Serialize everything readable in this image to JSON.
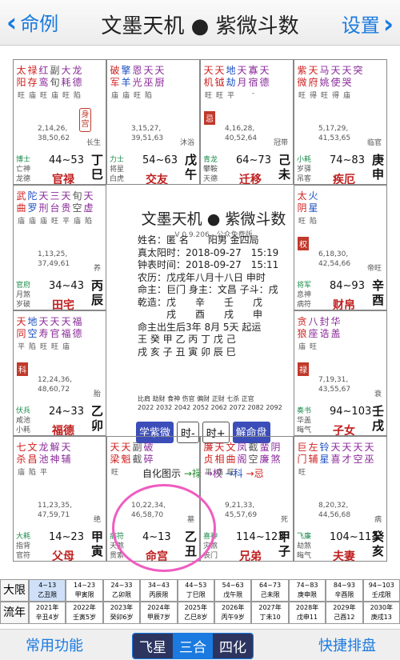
{
  "nav": {
    "back_label": "命例",
    "title": "文墨天机 ● 紫微斗数",
    "settings_label": "设置"
  },
  "cells": [
    {
      "id": "si",
      "col": 0,
      "row": 0,
      "stars": [
        {
          "n": "太阳",
          "c": "red",
          "b": "旺"
        },
        {
          "n": "禄存",
          "c": "red",
          "b": "庙"
        },
        {
          "n": "红鸾",
          "c": "purple",
          "b": "旺"
        },
        {
          "n": "副旬",
          "c": "gray",
          "b": "庙"
        },
        {
          "n": "大耗",
          "c": "purple",
          "b": "旺"
        },
        {
          "n": "龙德",
          "c": "purple",
          "b": "陷"
        }
      ],
      "ages": [
        "2,14,26,",
        "38,50,62"
      ],
      "cs": "长生",
      "gods": [
        "博士",
        "亡神",
        "龙德"
      ],
      "range": "44~53",
      "palace": "官禄",
      "stem": [
        "丁",
        "巳"
      ],
      "shen": "身宫"
    },
    {
      "id": "wu",
      "col": 1,
      "row": 0,
      "stars": [
        {
          "n": "破军",
          "c": "red",
          "b": "庙"
        },
        {
          "n": "擎羊",
          "c": "blue",
          "b": "庙"
        },
        {
          "n": "恩光",
          "c": "purple",
          "b": "旺"
        },
        {
          "n": "天巫",
          "c": "purple",
          "b": "陷"
        },
        {
          "n": "天厨",
          "c": "purple",
          "b": ""
        }
      ],
      "ages": [
        "3,15,27,",
        "39,51,63"
      ],
      "cs": "沐浴",
      "gods": [
        "力士",
        "将星",
        "白虎"
      ],
      "range": "54~63",
      "palace": "交友",
      "stem": [
        "戊",
        "午"
      ]
    },
    {
      "id": "wei",
      "col": 2,
      "row": 0,
      "stars": [
        {
          "n": "天机",
          "c": "red",
          "b": "旺"
        },
        {
          "n": "天钺",
          "c": "red",
          "b": "旺"
        },
        {
          "n": "地劫",
          "c": "blue",
          "b": "平"
        },
        {
          "n": "天月",
          "c": "purple",
          "b": ""
        },
        {
          "n": "寡宿",
          "c": "purple",
          "b": "-"
        },
        {
          "n": "天德",
          "c": "purple",
          "b": ""
        }
      ],
      "hua": "忌",
      "ages": [
        "4,16,28,",
        "40,52,64"
      ],
      "cs": "冠带",
      "gods": [
        "青龙",
        "攀鞍",
        "天德"
      ],
      "range": "64~73",
      "palace": "迁移",
      "stem": [
        "己",
        "未"
      ]
    },
    {
      "id": "shen",
      "col": 3,
      "row": 0,
      "stars": [
        {
          "n": "紫微",
          "c": "red",
          "b": "旺"
        },
        {
          "n": "天府",
          "c": "red",
          "b": "得"
        },
        {
          "n": "马姚",
          "c": "purple",
          "b": "旺"
        },
        {
          "n": "天使",
          "c": "purple",
          "b": "得"
        },
        {
          "n": "天哭",
          "c": "purple",
          "b": "庙"
        },
        {
          "n": "突",
          "c": "purple",
          "b": ""
        }
      ],
      "ages": [
        "5,17,29,",
        "41,53,65"
      ],
      "cs": "临官",
      "gods": [
        "小耗",
        "岁驿",
        "吊客"
      ],
      "range": "74~83",
      "palace": "疾厄",
      "stem": [
        "庚",
        "申"
      ]
    },
    {
      "id": "chen",
      "col": 0,
      "row": 1,
      "stars": [
        {
          "n": "武曲",
          "c": "red",
          "b": "庙"
        },
        {
          "n": "陀罗",
          "c": "blue",
          "b": "庙"
        },
        {
          "n": "天刑",
          "c": "purple",
          "b": "庙"
        },
        {
          "n": "三台",
          "c": "purple",
          "b": "旺"
        },
        {
          "n": "天贵",
          "c": "purple",
          "b": "平"
        },
        {
          "n": "旬空",
          "c": "gray",
          "b": "庙"
        },
        {
          "n": "天虚",
          "c": "purple",
          "b": "陷"
        }
      ],
      "ages": [
        "1,13,25,",
        "37,49,61"
      ],
      "cs": "养",
      "gods": [
        "官府",
        "月煞",
        "岁破"
      ],
      "range": "34~43",
      "palace": "田宅",
      "stem": [
        "丙",
        "辰"
      ]
    },
    {
      "id": "you",
      "col": 3,
      "row": 1,
      "stars": [
        {
          "n": "太阴",
          "c": "red",
          "b": "旺"
        },
        {
          "n": "火星",
          "c": "blue",
          "b": "陷"
        }
      ],
      "hua": "权",
      "ages": [
        "6,18,30,",
        "42,54,66"
      ],
      "cs": "帝旺",
      "gods": [
        "将军",
        "息神",
        "病符"
      ],
      "range": "84~93",
      "palace": "财帛",
      "stem": [
        "辛",
        "酉"
      ]
    },
    {
      "id": "mao",
      "col": 0,
      "row": 2,
      "stars": [
        {
          "n": "天同",
          "c": "red",
          "b": "平"
        },
        {
          "n": "地空",
          "c": "blue",
          "b": "陷"
        },
        {
          "n": "天寿",
          "c": "purple",
          "b": "旺"
        },
        {
          "n": "天官",
          "c": "purple",
          "b": "旺"
        },
        {
          "n": "天福",
          "c": "purple",
          "b": "庙"
        },
        {
          "n": "福德",
          "c": "purple",
          "b": ""
        }
      ],
      "hua": "科",
      "ages": [
        "12,24,36,",
        "48,60,72"
      ],
      "cs": "胎",
      "gods": [
        "伏兵",
        "咸池",
        "小耗"
      ],
      "range": "24~33",
      "palace": "福德",
      "stem": [
        "乙",
        "卯"
      ]
    },
    {
      "id": "xu",
      "col": 3,
      "row": 2,
      "stars": [
        {
          "n": "贪狼",
          "c": "red",
          "b": "庙"
        },
        {
          "n": "八座",
          "c": "purple",
          "b": "旺"
        },
        {
          "n": "封诰",
          "c": "purple",
          "b": ""
        },
        {
          "n": "华盖",
          "c": "purple",
          "b": ""
        }
      ],
      "hua": "禄",
      "ages": [
        "7,19,31,",
        "43,55,67"
      ],
      "cs": "衰",
      "gods": [
        "奏书",
        "华盖",
        "晦气"
      ],
      "range": "94~103",
      "palace": "子女",
      "stem": [
        "壬",
        "戌"
      ]
    },
    {
      "id": "yin",
      "col": 0,
      "row": 3,
      "stars": [
        {
          "n": "七杀",
          "c": "red",
          "b": "庙"
        },
        {
          "n": "文昌",
          "c": "red",
          "b": "陷"
        },
        {
          "n": "龙池",
          "c": "purple",
          "b": "平"
        },
        {
          "n": "解神",
          "c": "purple",
          "b": ""
        },
        {
          "n": "天辅",
          "c": "purple",
          "b": ""
        }
      ],
      "ages": [
        "11,23,35,",
        "47,59,71"
      ],
      "cs": "绝",
      "gods": [
        "大耗",
        "指背",
        "官符"
      ],
      "range": "14~23",
      "palace": "父母",
      "stem": [
        "甲",
        "寅"
      ]
    },
    {
      "id": "chou",
      "col": 1,
      "row": 3,
      "stars": [
        {
          "n": "天梁",
          "c": "red",
          "b": "旺"
        },
        {
          "n": "天魁",
          "c": "red",
          "b": ""
        },
        {
          "n": "副截",
          "c": "gray",
          "b": ""
        },
        {
          "n": "破碎",
          "c": "purple",
          "b": ""
        }
      ],
      "ages": [
        "10,22,34,",
        "46,58,70"
      ],
      "cs": "墓",
      "gods": [
        "病符",
        "天煞",
        "贯索"
      ],
      "range": "4~13",
      "palace": "命宫",
      "stem": [
        "乙",
        "丑"
      ]
    },
    {
      "id": "zi",
      "col": 2,
      "row": 3,
      "stars": [
        {
          "n": "廉贞",
          "c": "red",
          "b": "平"
        },
        {
          "n": "天相",
          "c": "red",
          "b": "庙"
        },
        {
          "n": "文曲",
          "c": "red",
          "b": "旺"
        },
        {
          "n": "凤阁",
          "c": "purple",
          "b": ""
        },
        {
          "n": "截空",
          "c": "gray",
          "b": ""
        },
        {
          "n": "蜚廉",
          "c": "purple",
          "b": ""
        },
        {
          "n": "阴煞",
          "c": "purple",
          "b": ""
        },
        {
          "n": "年解",
          "c": "purple",
          "b": ""
        }
      ],
      "ages": [
        "9,21,33,",
        "45,57,69"
      ],
      "cs": "死",
      "gods": [
        "喜神",
        "灾煞",
        "丧门"
      ],
      "range": "114~123",
      "palace": "兄弟",
      "stem": [
        "甲",
        "子"
      ]
    },
    {
      "id": "hai",
      "col": 3,
      "row": 3,
      "stars": [
        {
          "n": "巨门",
          "c": "red",
          "b": "旺"
        },
        {
          "n": "左辅",
          "c": "red",
          "b": ""
        },
        {
          "n": "铃星",
          "c": "blue",
          "b": ""
        },
        {
          "n": "天喜",
          "c": "purple",
          "b": ""
        },
        {
          "n": "天才",
          "c": "purple",
          "b": ""
        },
        {
          "n": "天空",
          "c": "purple",
          "b": ""
        },
        {
          "n": "天巫",
          "c": "purple",
          "b": ""
        },
        {
          "n": "孤辰",
          "c": "purple",
          "b": ""
        }
      ],
      "ages": [
        "8,20,32,",
        "44,56,68"
      ],
      "cs": "病",
      "gods": [
        "飞廉",
        "劫煞",
        "晦气"
      ],
      "range": "104~113",
      "palace": "夫妻",
      "stem": [
        "癸",
        "亥"
      ]
    }
  ],
  "center": {
    "title": "文墨天机 ● 紫微斗数",
    "version": "V 0.9.206 - 公众免费版",
    "info": [
      "姓名：匿 名　　阳男 金四局",
      "真太阳时：2018-09-27　15:19",
      "钟表时间：2018-09-27　15:11",
      "农历：戊戌年八月十八日 申时",
      "命主：巨门 身主：文昌 子斗：戌",
      "乾造：戊　　辛　　壬　　戊",
      "　　　戌　　酉　　戌　　申",
      "命主出生后3年 8月 5天 起运",
      "王 癸 甲 乙 丙 丁 戊 己",
      "戌 亥 子 丑 寅 卯 辰 巳"
    ],
    "wx": "比肩 劫财 食神 伤官 偏财 正财 七杀 正官",
    "years": "2022 2032 2042 2052 2062 2072 2082 2092",
    "buttons": [
      "学紫微",
      "时-",
      "时+",
      "解命盘"
    ],
    "flow": [
      "自化图示",
      "→禄",
      "→权",
      "→科",
      "→忌"
    ]
  },
  "daxian": [
    {
      "t": "4~13",
      "y": "乙丑限"
    },
    {
      "t": "14~23",
      "y": "甲寅限"
    },
    {
      "t": "24~33",
      "y": "乙卯限"
    },
    {
      "t": "34~43",
      "y": "丙辰限"
    },
    {
      "t": "44~53",
      "y": "丁巳限"
    },
    {
      "t": "54~63",
      "y": "戊午限"
    },
    {
      "t": "64~73",
      "y": "己未限"
    },
    {
      "t": "74~83",
      "y": "庚申限"
    },
    {
      "t": "84~93",
      "y": "辛酉限"
    },
    {
      "t": "94~103",
      "y": "壬戌限"
    }
  ],
  "liunian": [
    {
      "t": "2021年",
      "y": "辛丑4岁"
    },
    {
      "t": "2022年",
      "y": "壬寅5岁"
    },
    {
      "t": "2023年",
      "y": "癸卯6岁"
    },
    {
      "t": "2024年",
      "y": "甲辰7岁"
    },
    {
      "t": "2025年",
      "y": "乙巳8岁"
    },
    {
      "t": "2026年",
      "y": "丙午9岁"
    },
    {
      "t": "2027年",
      "y": "丁未10"
    },
    {
      "t": "2028年",
      "y": "戊申11"
    },
    {
      "t": "2029年",
      "y": "己酉12"
    },
    {
      "t": "2030年",
      "y": "庚戌13"
    }
  ],
  "labels": {
    "daxian": "大限",
    "liunian": "流年"
  },
  "tabbar": {
    "left": "常用功能",
    "seg": [
      "飞星",
      "三合",
      "四化"
    ],
    "right": "快捷排盘"
  }
}
